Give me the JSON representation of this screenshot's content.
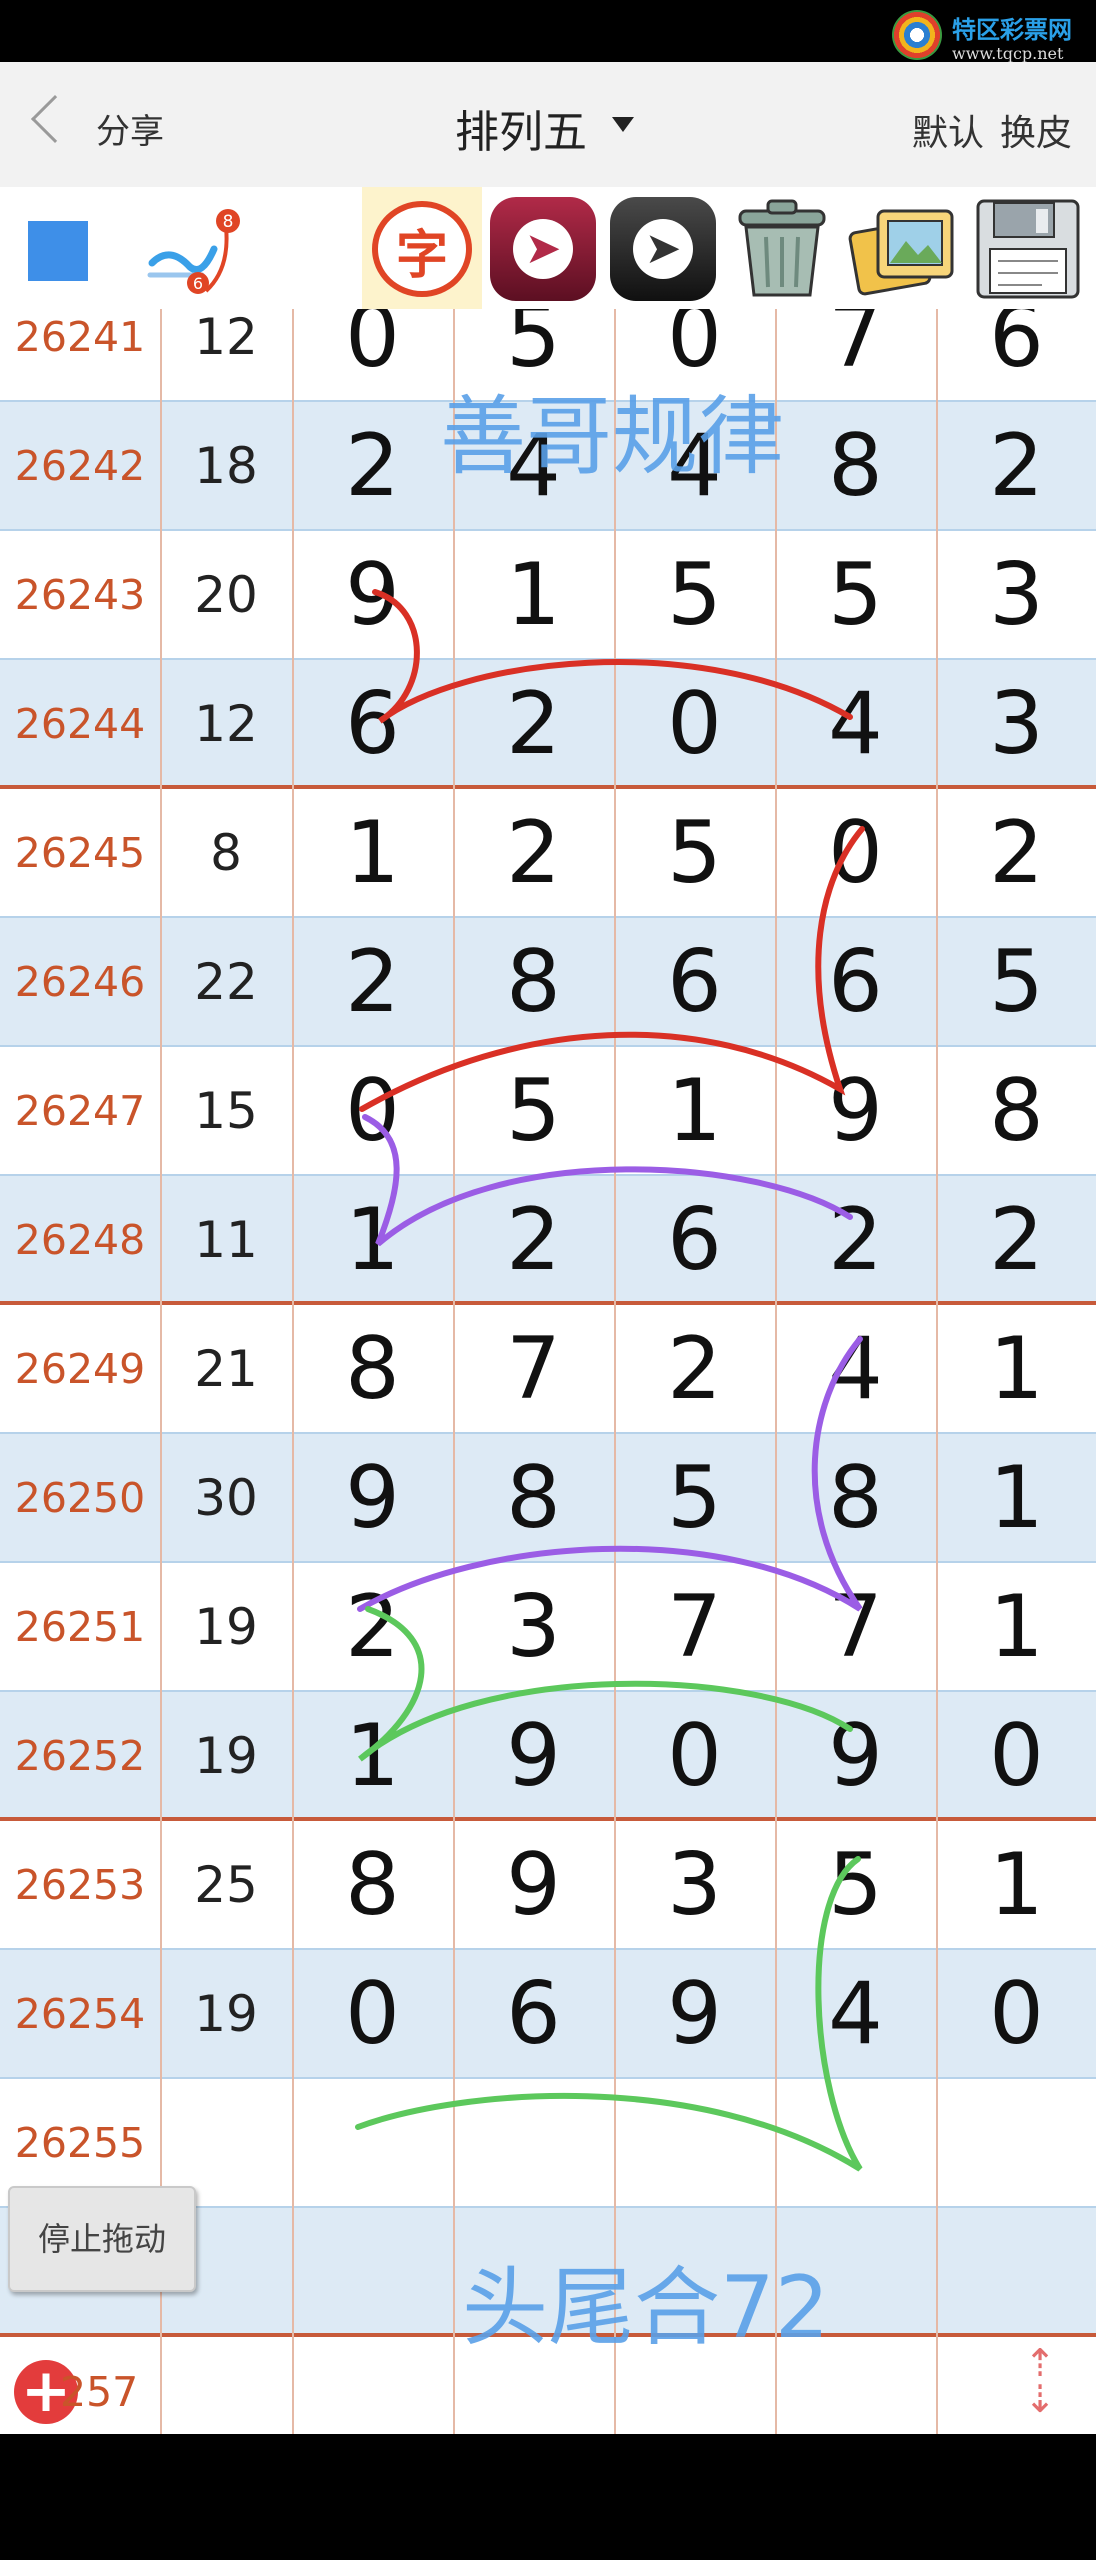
{
  "watermark": {
    "title": "特区彩票网",
    "url": "www.tqcp.net"
  },
  "header": {
    "share_label": "分享",
    "title": "排列五",
    "default_label": "默认",
    "skin_label": "换皮"
  },
  "toolbar": {
    "char_tool_label": "字",
    "pen_badge_top": "8",
    "pen_badge_bottom": "6",
    "tools": [
      "color-square",
      "pen",
      "char",
      "undo",
      "redo",
      "trash",
      "photo",
      "save"
    ]
  },
  "rows": [
    {
      "issue": "26241",
      "sum": "12",
      "digits": [
        "0",
        "5",
        "0",
        "7",
        "6"
      ]
    },
    {
      "issue": "26242",
      "sum": "18",
      "digits": [
        "2",
        "4",
        "4",
        "8",
        "2"
      ]
    },
    {
      "issue": "26243",
      "sum": "20",
      "digits": [
        "9",
        "1",
        "5",
        "5",
        "3"
      ]
    },
    {
      "issue": "26244",
      "sum": "12",
      "digits": [
        "6",
        "2",
        "0",
        "4",
        "3"
      ]
    },
    {
      "issue": "26245",
      "sum": "8",
      "digits": [
        "1",
        "2",
        "5",
        "0",
        "2"
      ]
    },
    {
      "issue": "26246",
      "sum": "22",
      "digits": [
        "2",
        "8",
        "6",
        "6",
        "5"
      ]
    },
    {
      "issue": "26247",
      "sum": "15",
      "digits": [
        "0",
        "5",
        "1",
        "9",
        "8"
      ]
    },
    {
      "issue": "26248",
      "sum": "11",
      "digits": [
        "1",
        "2",
        "6",
        "2",
        "2"
      ]
    },
    {
      "issue": "26249",
      "sum": "21",
      "digits": [
        "8",
        "7",
        "2",
        "4",
        "1"
      ]
    },
    {
      "issue": "26250",
      "sum": "30",
      "digits": [
        "9",
        "8",
        "5",
        "8",
        "1"
      ]
    },
    {
      "issue": "26251",
      "sum": "19",
      "digits": [
        "2",
        "3",
        "7",
        "7",
        "1"
      ]
    },
    {
      "issue": "26252",
      "sum": "19",
      "digits": [
        "1",
        "9",
        "0",
        "9",
        "0"
      ]
    },
    {
      "issue": "26253",
      "sum": "25",
      "digits": [
        "8",
        "9",
        "3",
        "5",
        "1"
      ]
    },
    {
      "issue": "26254",
      "sum": "19",
      "digits": [
        "0",
        "6",
        "9",
        "4",
        "0"
      ]
    },
    {
      "issue": "26255",
      "sum": "",
      "digits": [
        "",
        "",
        "",
        "",
        ""
      ]
    },
    {
      "issue": "",
      "sum": "",
      "digits": [
        "",
        "",
        "",
        "",
        ""
      ]
    }
  ],
  "annotations": {
    "top_note": "善哥规律",
    "bottom_note": "头尾合72",
    "stroke_colors": [
      "#d93025",
      "#9b5de5",
      "#5cc85c"
    ]
  },
  "controls": {
    "stop_drag_label": "停止拖动",
    "bottom_issue_fragment": "257"
  },
  "colors": {
    "issue_text": "#c9542a",
    "alt_row": "#ddeaf5",
    "group_separator": "#c75a3a",
    "accent_blue": "#3e8fe8"
  }
}
